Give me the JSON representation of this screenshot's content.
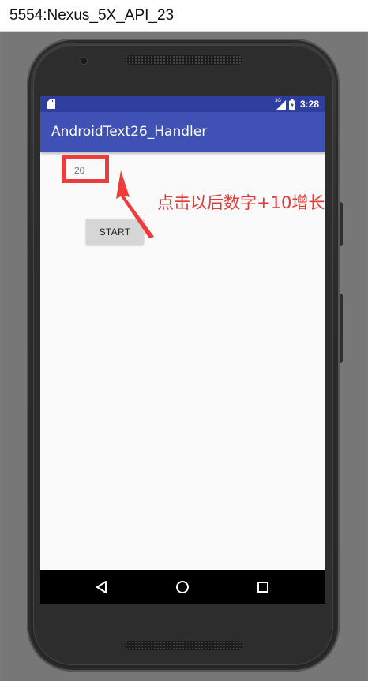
{
  "window": {
    "title": "5554:Nexus_5X_API_23"
  },
  "status_bar": {
    "network": "3G",
    "time": "3:28",
    "icons": [
      "sd-card-icon",
      "signal-icon",
      "battery-icon"
    ]
  },
  "app_bar": {
    "title": "AndroidText26_Handler"
  },
  "content": {
    "counter_value": "20",
    "start_label": "START"
  },
  "annotation": {
    "text": "点击以后数字+10增长",
    "color": "#e53935"
  },
  "navigation": {
    "icons": [
      "back-icon",
      "home-icon",
      "recents-icon"
    ]
  },
  "colors": {
    "status_bar": "#303f9f",
    "app_bar": "#3f51b5",
    "highlight": "#ef3b3b"
  }
}
